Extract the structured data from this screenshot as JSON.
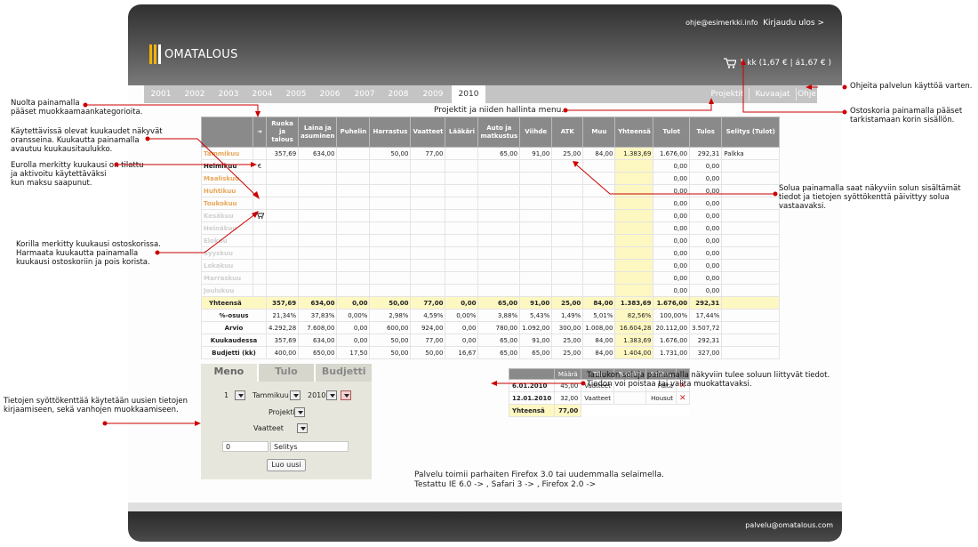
{
  "header": {
    "logo_text": "OMATALOUS",
    "user_email": "ohje@esimerkki.info",
    "logout": "Kirjaudu ulos >",
    "cart_text": "1 kk (1,67 € | á1,67 € )",
    "cart_icon": "shopping-cart-icon"
  },
  "nav": {
    "years": [
      "2001",
      "2002",
      "2003",
      "2004",
      "2005",
      "2006",
      "2007",
      "2008",
      "2009",
      "2010"
    ],
    "active_year": "2010",
    "menu": [
      "Projektit",
      "Kuvaajat",
      "Ohje"
    ]
  },
  "project_note": "Projektit ja niiden hallinta menu.",
  "table": {
    "arrow": "➔",
    "columns": [
      "Ruoka ja talous",
      "Laina ja asuminen",
      "Puhelin",
      "Harrastus",
      "Vaatteet",
      "Lääkäri",
      "Auto ja matkustus",
      "Viihde",
      "ATK",
      "Muu",
      "Yhteensä",
      "Tulot",
      "Tulos",
      "Selitys (Tulot)"
    ],
    "months": [
      {
        "name": "Tammikuu",
        "mark": "",
        "values": [
          "357,69",
          "634,00",
          "",
          "50,00",
          "77,00",
          "",
          "65,00",
          "91,00",
          "25,00",
          "84,00",
          "1.383,69",
          "1.676,00",
          "292,31",
          "Palkka"
        ]
      },
      {
        "name": "Helmikuu",
        "mark": "€",
        "values": [
          "",
          "",
          "",
          "",
          "",
          "",
          "",
          "",
          "",
          "",
          "",
          "0,00",
          "0,00",
          ""
        ]
      },
      {
        "name": "Maaliskuu",
        "mark": "",
        "values": [
          "",
          "",
          "",
          "",
          "",
          "",
          "",
          "",
          "",
          "",
          "",
          "0,00",
          "0,00",
          ""
        ]
      },
      {
        "name": "Huhtikuu",
        "mark": "",
        "values": [
          "",
          "",
          "",
          "",
          "",
          "",
          "",
          "",
          "",
          "",
          "",
          "0,00",
          "0,00",
          ""
        ]
      },
      {
        "name": "Toukokuu",
        "mark": "",
        "values": [
          "",
          "",
          "",
          "",
          "",
          "",
          "",
          "",
          "",
          "",
          "",
          "0,00",
          "0,00",
          ""
        ]
      },
      {
        "name": "Kesäkuu",
        "mark": "cart",
        "values": [
          "",
          "",
          "",
          "",
          "",
          "",
          "",
          "",
          "",
          "",
          "",
          "0,00",
          "0,00",
          ""
        ]
      },
      {
        "name": "Heinäkuu",
        "mark": "",
        "values": [
          "",
          "",
          "",
          "",
          "",
          "",
          "",
          "",
          "",
          "",
          "",
          "0,00",
          "0,00",
          ""
        ]
      },
      {
        "name": "Elokuu",
        "mark": "",
        "values": [
          "",
          "",
          "",
          "",
          "",
          "",
          "",
          "",
          "",
          "",
          "",
          "0,00",
          "0,00",
          ""
        ]
      },
      {
        "name": "Syyskuu",
        "mark": "",
        "values": [
          "",
          "",
          "",
          "",
          "",
          "",
          "",
          "",
          "",
          "",
          "",
          "0,00",
          "0,00",
          ""
        ]
      },
      {
        "name": "Lokakuu",
        "mark": "",
        "values": [
          "",
          "",
          "",
          "",
          "",
          "",
          "",
          "",
          "",
          "",
          "",
          "0,00",
          "0,00",
          ""
        ]
      },
      {
        "name": "Marraskuu",
        "mark": "",
        "values": [
          "",
          "",
          "",
          "",
          "",
          "",
          "",
          "",
          "",
          "",
          "",
          "0,00",
          "0,00",
          ""
        ]
      },
      {
        "name": "Joulukuu",
        "mark": "",
        "values": [
          "",
          "",
          "",
          "",
          "",
          "",
          "",
          "",
          "",
          "",
          "",
          "0,00",
          "0,00",
          ""
        ]
      }
    ],
    "summary": [
      {
        "label": "Yhteensä",
        "values": [
          "357,69",
          "634,00",
          "0,00",
          "50,00",
          "77,00",
          "0,00",
          "65,00",
          "91,00",
          "25,00",
          "84,00",
          "1.383,69",
          "1.676,00",
          "292,31",
          ""
        ]
      },
      {
        "label": "%-osuus",
        "values": [
          "21,34%",
          "37,83%",
          "0,00%",
          "2,98%",
          "4,59%",
          "0,00%",
          "3,88%",
          "5,43%",
          "1,49%",
          "5,01%",
          "82,56%",
          "100,00%",
          "17,44%",
          ""
        ]
      },
      {
        "label": "Arvio",
        "values": [
          "4.292,28",
          "7.608,00",
          "0,00",
          "600,00",
          "924,00",
          "0,00",
          "780,00",
          "1.092,00",
          "300,00",
          "1.008,00",
          "16.604,28",
          "20.112,00",
          "3.507,72",
          ""
        ]
      },
      {
        "label": "Kuukaudessa",
        "values": [
          "357,69",
          "634,00",
          "0,00",
          "50,00",
          "77,00",
          "0,00",
          "65,00",
          "91,00",
          "25,00",
          "84,00",
          "1.383,69",
          "1.676,00",
          "292,31",
          ""
        ]
      },
      {
        "label": "Budjetti (kk)",
        "values": [
          "400,00",
          "650,00",
          "17,50",
          "50,00",
          "50,00",
          "16,67",
          "65,00",
          "65,00",
          "25,00",
          "84,00",
          "1.404,00",
          "1.731,00",
          "327,00",
          ""
        ]
      }
    ]
  },
  "form": {
    "tabs": [
      "Meno",
      "Tulo",
      "Budjetti"
    ],
    "day": "1",
    "month": "Tammikuu",
    "year": "2010",
    "project": "Projekti",
    "category": "Vaatteet",
    "amount": "0",
    "description": "Selitys",
    "submit": "Luo uusi"
  },
  "entries": {
    "columns": [
      "Määrä",
      "Tili",
      "Projekti",
      "Selitys"
    ],
    "rows": [
      {
        "date": "6.01.2010",
        "amount": "45,00",
        "account": "Vaatteet",
        "project": "",
        "desc": "Paita",
        "delete": "✕"
      },
      {
        "date": "12.01.2010",
        "amount": "32,00",
        "account": "Vaatteet",
        "project": "",
        "desc": "Housut",
        "delete": "✕"
      }
    ],
    "total_label": "Yhteensä",
    "total": "77,00"
  },
  "notice": {
    "line1": "Palvelu toimii parhaiten Firefox 3.0 tai uudemmalla selaimella.",
    "line2": "Testattu IE 6.0 -> , Safari 3 -> , Firefox 2.0 ->"
  },
  "footer": {
    "contact": "palvelu@omatalous.com"
  },
  "annotations": {
    "a1": [
      "Nuolta painamalla",
      "pääset muokkaamaankategorioita."
    ],
    "a2": [
      "Käytettävissä olevat kuukaudet näkyvät",
      "oransseina. Kuukautta painamalla",
      "avautuu kuukausitaulukko."
    ],
    "a3": [
      "Eurolla merkitty kuukausi on tilattu",
      "ja aktivoitu käytettäväksi",
      "kun maksu saapunut."
    ],
    "a4": [
      "Korilla merkitty kuukausi ostoskorissa.",
      "Harmaata kuukautta painamalla",
      "kuukausi ostoskoriin ja pois korista."
    ],
    "a5": [
      "Tietojen syöttökenttää käytetään uusien tietojen",
      "kirjaamiseen, sekä vanhojen muokkaamiseen."
    ],
    "a6": [
      "Ohjeita palvelun käyttöä varten."
    ],
    "a7": [
      "Ostoskoria painamalla pääset",
      "tarkistamaan korin sisällön."
    ],
    "a8": [
      "Solua painamalla saat näkyviin solun sisältämät",
      "tiedot ja tietojen syöttökenttä päivittyy solua",
      "vastaavaksi."
    ],
    "a9": [
      "Taulukon soluja painamalla näkyviin tulee soluun liittyvät tiedot.",
      "Tiedon voi poistaa tai valita muokattavaksi."
    ]
  }
}
